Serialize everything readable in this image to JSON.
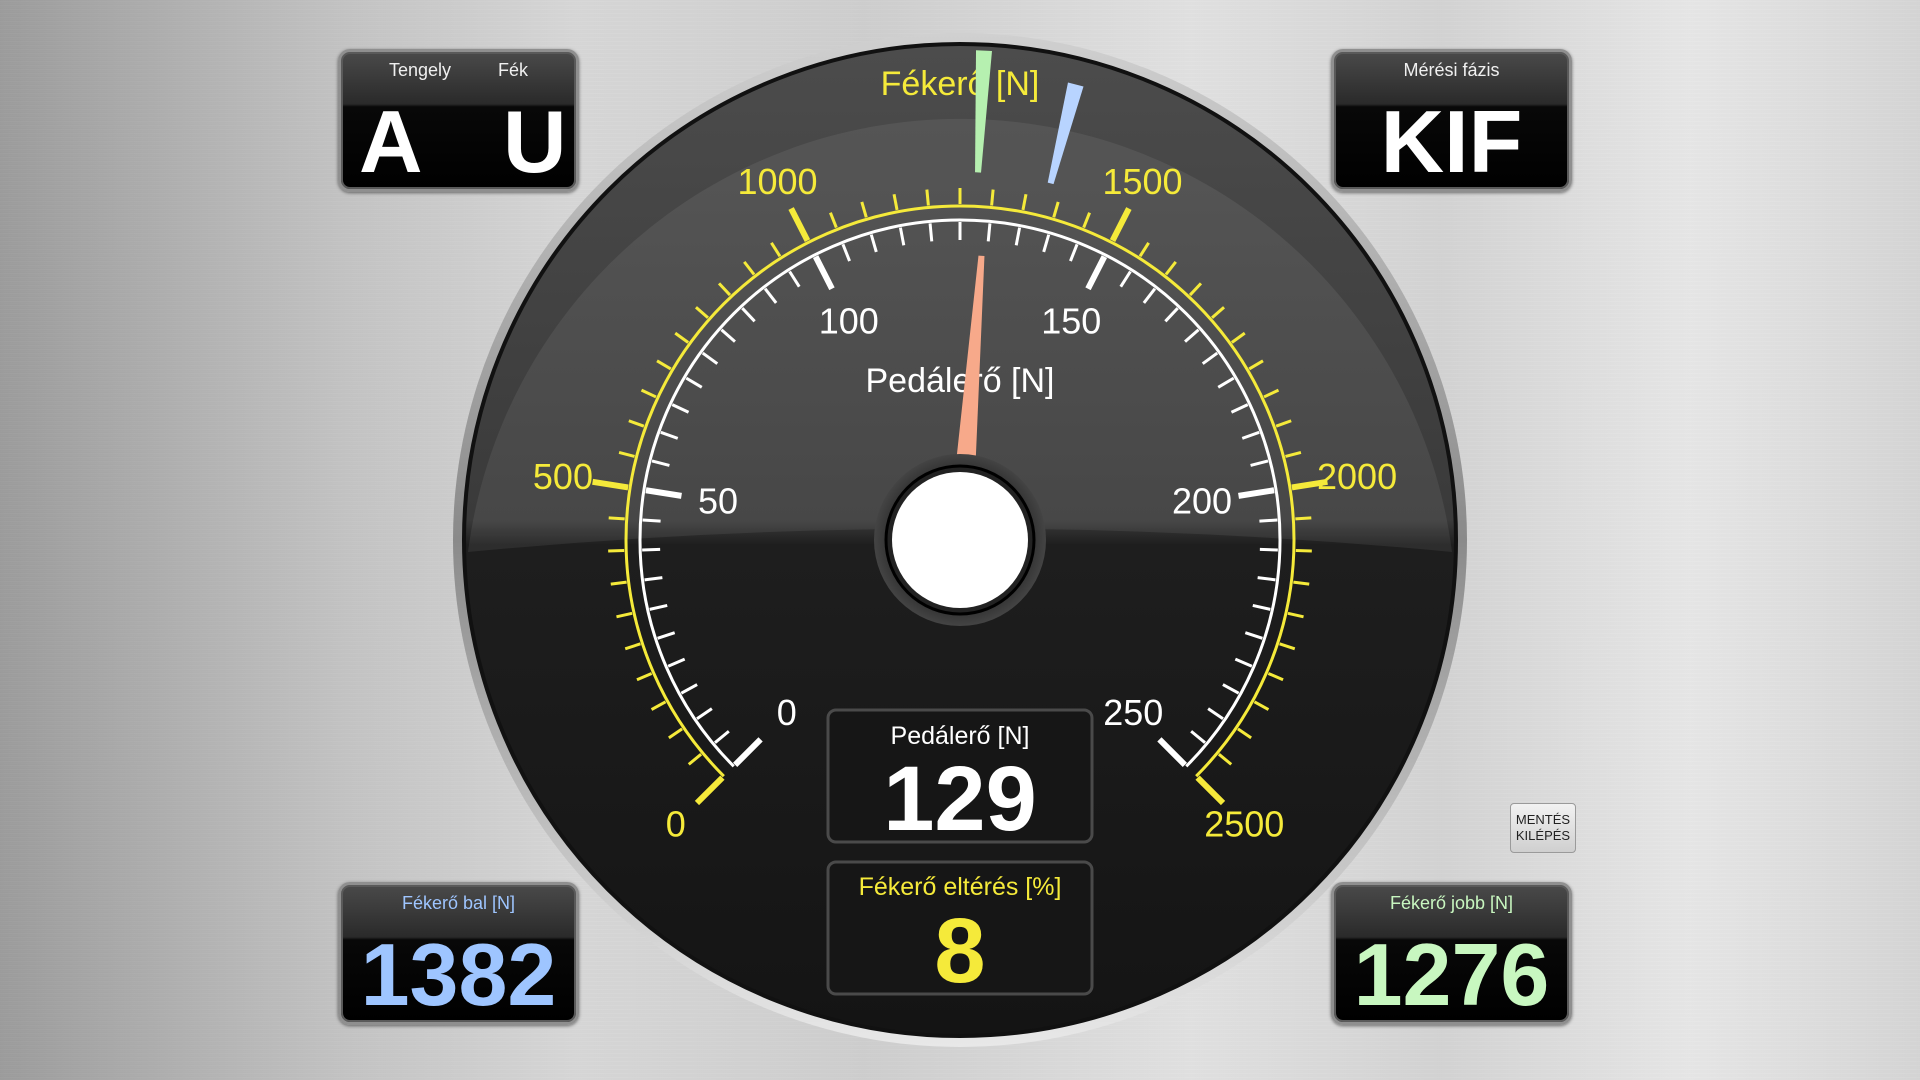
{
  "axle_panel": {
    "axle_label": "Tengely",
    "brake_label": "Fék",
    "axle_value": "A",
    "brake_value": "U"
  },
  "phase_panel": {
    "label": "Mérési fázis",
    "value": "KIF"
  },
  "left_panel": {
    "label": "Fékerő bal [N]",
    "value": "1382",
    "color": "#9ec5ff"
  },
  "right_panel": {
    "label": "Fékerő jobb [N]",
    "value": "1276",
    "color": "#c8f7c0"
  },
  "save_button": {
    "line1": "MENTÉS",
    "line2": "KILÉPÉS"
  },
  "gauge": {
    "outer_title": "Fékerő [N]",
    "inner_title": "Pedálerő [N]",
    "outer_min": 0,
    "outer_max": 2500,
    "outer_ticks": [
      "0",
      "500",
      "1000",
      "1500",
      "2000",
      "2500"
    ],
    "inner_min": 0,
    "inner_max": 250,
    "inner_ticks": [
      "0",
      "50",
      "100",
      "150",
      "200",
      "250"
    ],
    "outer_color": "#f5ea3a",
    "pedal_needle_value": 129,
    "pedal_needle_color": "#f7a98a",
    "brake_left_marker": 1382,
    "brake_left_color": "#b8d4ff",
    "brake_right_marker": 1276,
    "brake_right_color": "#b6f0b0"
  },
  "pedal_readout": {
    "label": "Pedálerő [N]",
    "value": "129"
  },
  "deviation_readout": {
    "label": "Fékerő eltérés [%]",
    "value": "8",
    "color": "#f5ea3a"
  }
}
